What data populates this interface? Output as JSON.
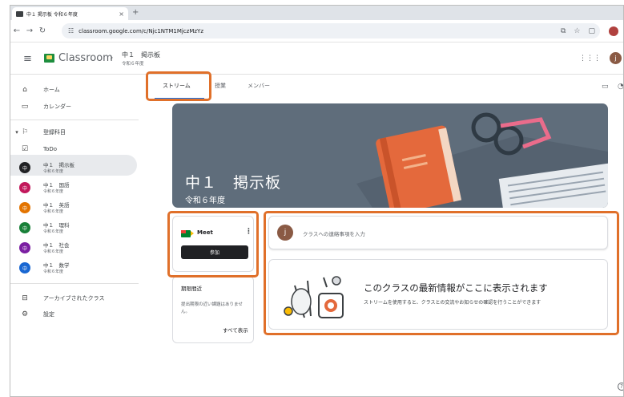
{
  "browser": {
    "tab_title": "中１ 掲示板 令和６年度",
    "tab_close": "×",
    "new_tab": "+",
    "url": "classroom.google.com/c/Njc1NTM1MjczMzYz"
  },
  "header": {
    "brand": "Classroom",
    "separator": "›",
    "course_title": "中１　掲示板",
    "course_subtitle": "令和６年度",
    "user_initial": "j"
  },
  "sidebar": {
    "home": "ホーム",
    "calendar": "カレンダー",
    "enrolled": "登録科目",
    "todo": "ToDo",
    "courses": [
      {
        "badge": "中",
        "name": "中１　掲示板",
        "sub": "令和６年度",
        "color": "#202124"
      },
      {
        "badge": "中",
        "name": "中１　国語",
        "sub": "令和６年度",
        "color": "#c2185b"
      },
      {
        "badge": "中",
        "name": "中１　英語",
        "sub": "令和６年度",
        "color": "#e37400"
      },
      {
        "badge": "中",
        "name": "中１　理科",
        "sub": "令和６年度",
        "color": "#188038"
      },
      {
        "badge": "中",
        "name": "中１　社会",
        "sub": "令和６年度",
        "color": "#7b1fa2"
      },
      {
        "badge": "中",
        "name": "中１　数学",
        "sub": "令和６年度",
        "color": "#1967d2"
      }
    ],
    "archived": "アーカイブされたクラス",
    "settings": "設定"
  },
  "tabs": [
    "ストリーム",
    "授業",
    "メンバー"
  ],
  "banner": {
    "title": "中１　掲示板",
    "subtitle": "令和６年度"
  },
  "meet": {
    "label": "Meet",
    "join": "参加"
  },
  "upcoming": {
    "title": "期限間近",
    "text": "提出期限の近い課題はありません。",
    "view_all": "すべて表示"
  },
  "announce": {
    "avatar": "j",
    "placeholder": "クラスへの連絡事項を入力"
  },
  "stream": {
    "title": "このクラスの最新情報がここに表示されます",
    "subtitle": "ストリームを使用すると、クラスとの交流やお知らせの確認を行うことができます"
  },
  "colors": {
    "highlight": "#e0702a",
    "banner": "#5f6d7b",
    "accent": "#1a73e8"
  }
}
